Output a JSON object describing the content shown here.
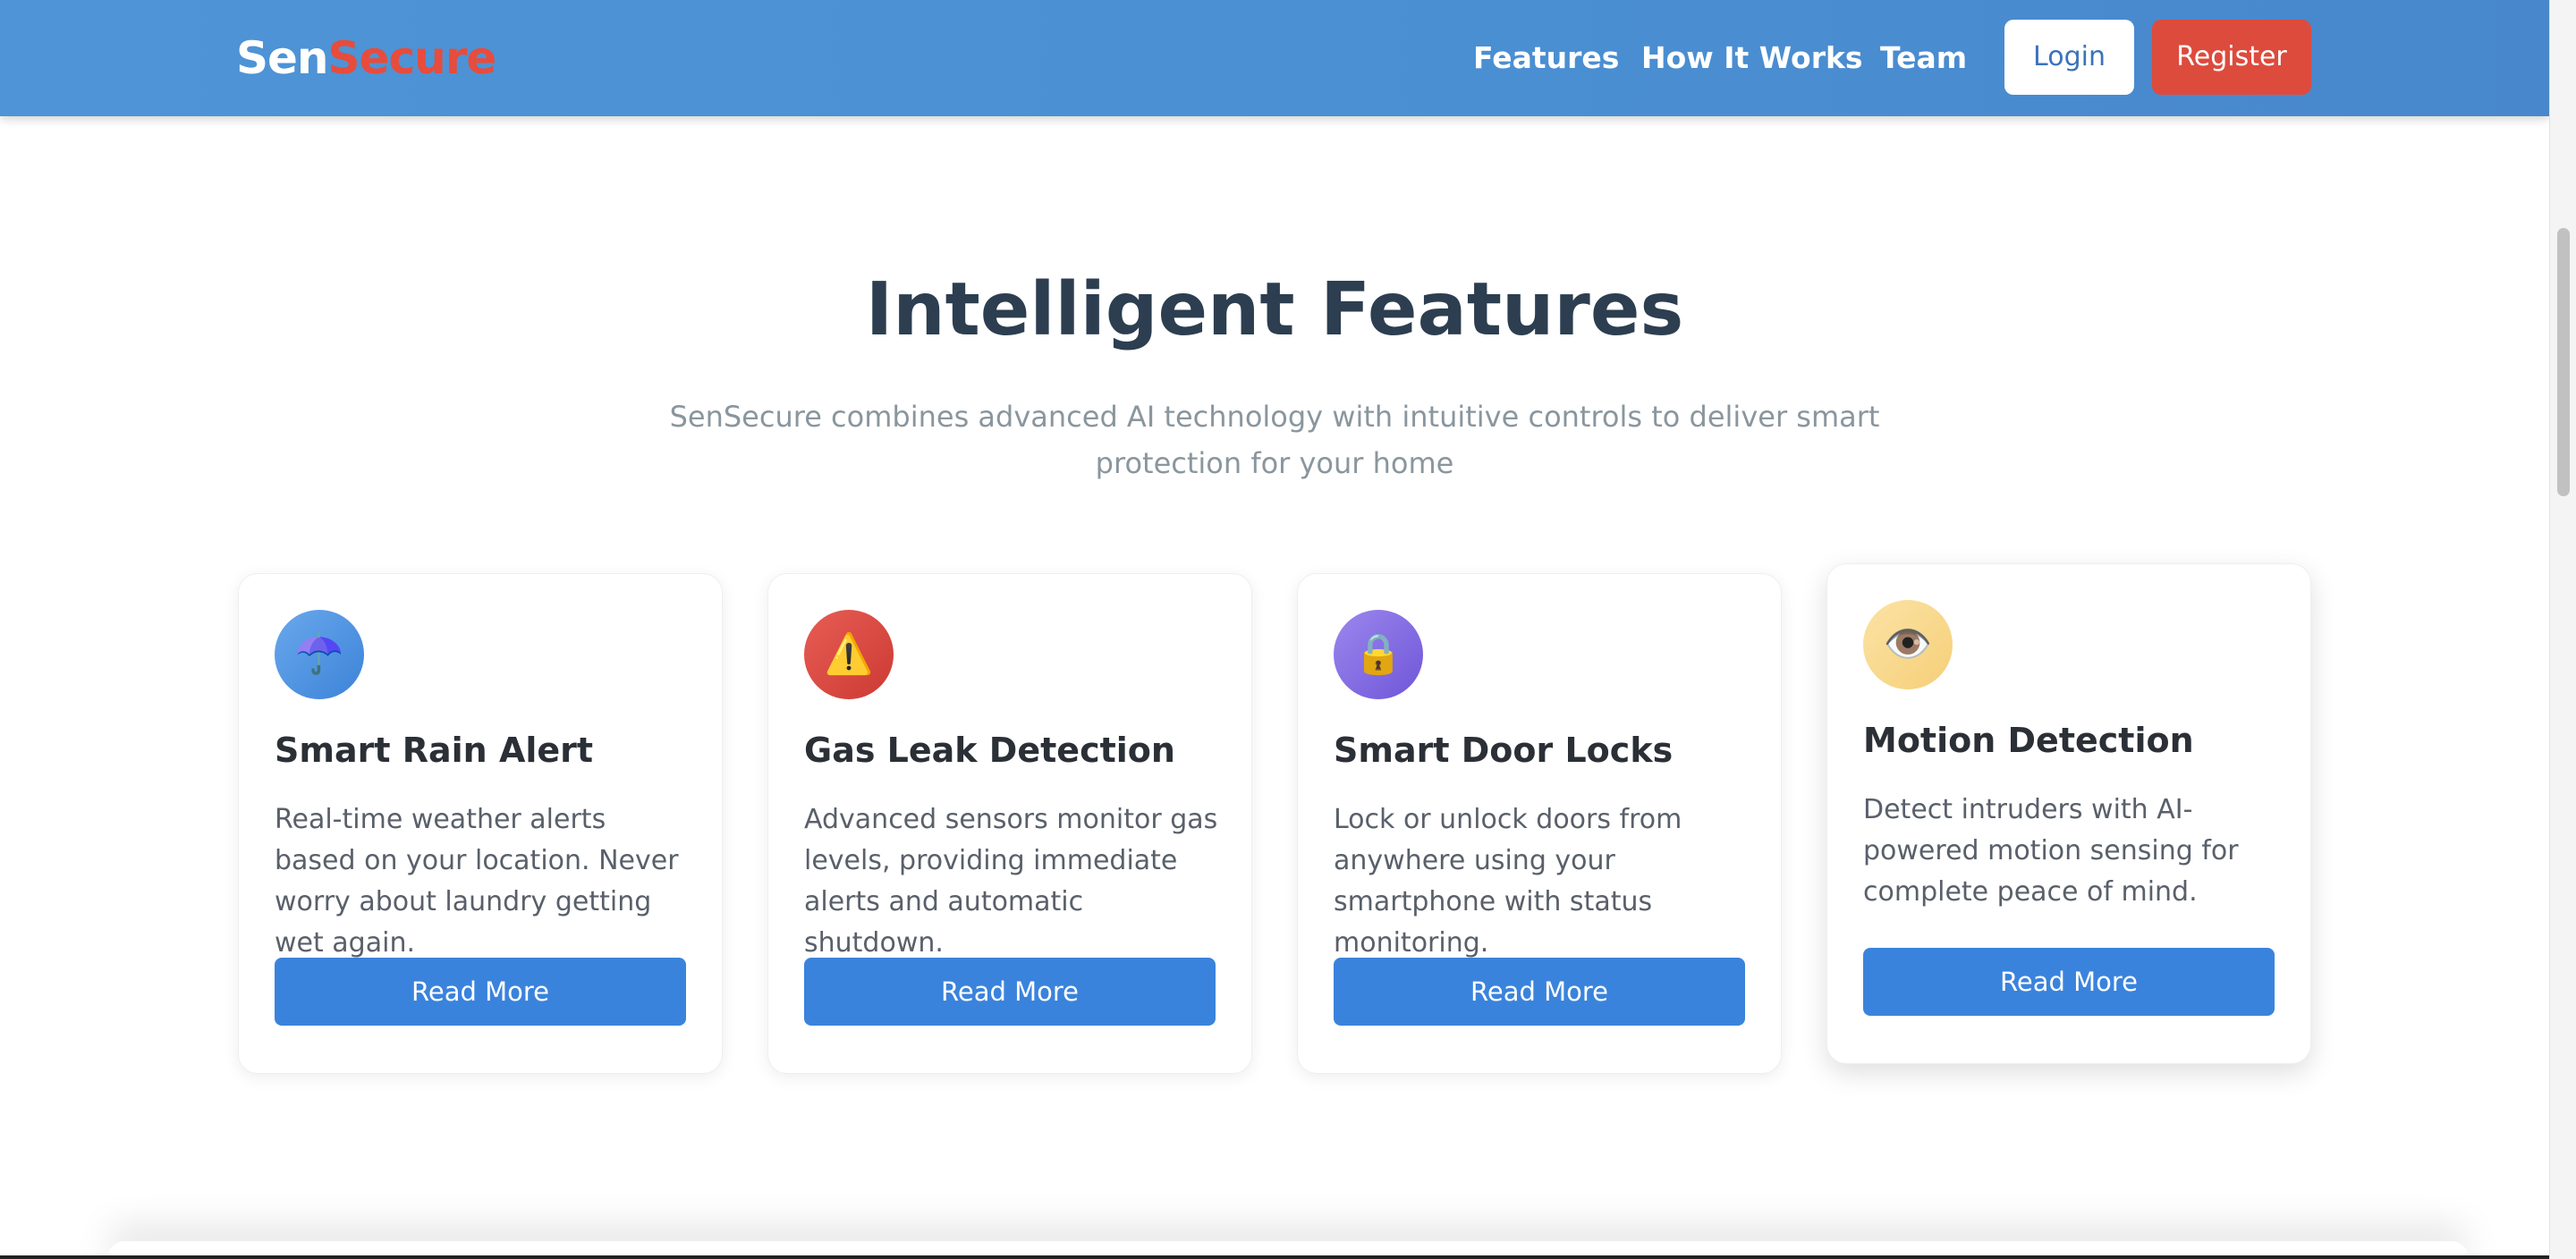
{
  "navbar": {
    "logo_part1": "Sen",
    "logo_part2": "Secure",
    "links": [
      "Features",
      "How It Works",
      "Team"
    ],
    "login_label": "Login",
    "register_label": "Register"
  },
  "features": {
    "title": "Intelligent Features",
    "subtitle": "SenSecure combines advanced AI technology with intuitive controls to deliver smart protection for your home",
    "cards": [
      {
        "icon": "umbrella-icon",
        "glyph": "☂️",
        "title": "Smart Rain Alert",
        "description": "Real-time weather alerts based on your location. Never worry about laundry getting wet again.",
        "button": "Read More"
      },
      {
        "icon": "warning-icon",
        "glyph": "⚠️",
        "title": "Gas Leak Detection",
        "description": "Advanced sensors monitor gas levels, providing immediate alerts and automatic shutdown.",
        "button": "Read More"
      },
      {
        "icon": "lock-icon",
        "glyph": "🔒",
        "title": "Smart Door Locks",
        "description": "Lock or unlock doors from anywhere using your smartphone with status monitoring.",
        "button": "Read More"
      },
      {
        "icon": "eye-icon",
        "glyph": "👁️",
        "title": "Motion Detection",
        "description": "Detect intruders with AI-powered motion sensing for complete peace of mind.",
        "button": "Read More"
      }
    ]
  },
  "colors": {
    "navbar": "#4a8fd2",
    "accent_red": "#dd4b3d",
    "button_blue": "#3a83dc",
    "heading": "#2c3e50"
  }
}
